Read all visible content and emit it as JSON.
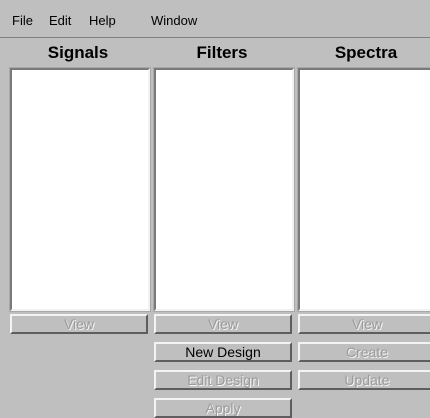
{
  "menu": {
    "file": "File",
    "edit": "Edit",
    "help": "Help",
    "window": "Window"
  },
  "columns": {
    "signals": {
      "title": "Signals",
      "view_label": "View",
      "view_enabled": false
    },
    "filters": {
      "title": "Filters",
      "view_label": "View",
      "new_design_label": "New Design",
      "edit_design_label": "Edit Design",
      "apply_label": "Apply"
    },
    "spectra": {
      "title": "Spectra",
      "view_label": "View",
      "create_label": "Create",
      "update_label": "Update"
    }
  },
  "colors": {
    "background": "#bfbfbf",
    "list_background": "#ffffff",
    "disabled_text": "#9b9b9b"
  }
}
